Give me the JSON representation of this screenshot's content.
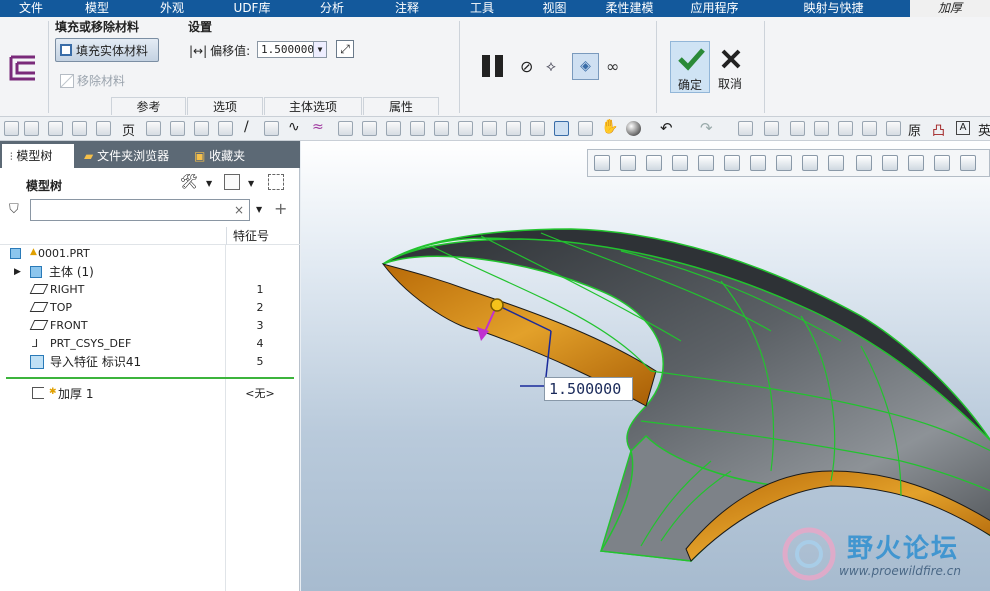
{
  "menubar": {
    "items": [
      "文件",
      "模型",
      "外观",
      "UDF库",
      "分析",
      "注释",
      "工具",
      "视图",
      "柔性建模",
      "应用程序",
      "映射与快捷"
    ],
    "active": "加厚"
  },
  "ribbon": {
    "fill_group_title": "填充或移除材料",
    "fill_solid_label": "填充实体材料",
    "remove_material_label": "移除材料",
    "settings_title": "设置",
    "offset_label": "偏移值:",
    "offset_value": "1.500000",
    "tabs": [
      "参考",
      "选项",
      "主体选项",
      "属性"
    ],
    "confirm_label": "确定",
    "cancel_label": "取消"
  },
  "toolbar_glyphs": {
    "page_letter": "页",
    "original_letter": "原",
    "text_letter": "A",
    "last_letter": "英"
  },
  "panel": {
    "tabs": [
      "模型树",
      "文件夹浏览器",
      "收藏夹"
    ],
    "tree_title": "模型树",
    "search_placeholder": "",
    "column_header": "特征号"
  },
  "tree": {
    "root": "0001.PRT",
    "rows": [
      {
        "name": "主体 (1)",
        "num": ""
      },
      {
        "name": "RIGHT",
        "num": "1"
      },
      {
        "name": "TOP",
        "num": "2"
      },
      {
        "name": "FRONT",
        "num": "3"
      },
      {
        "name": "PRT_CSYS_DEF",
        "num": "4"
      },
      {
        "name": "导入特征 标识41",
        "num": "5"
      }
    ],
    "active_feature": {
      "name": "加厚 1",
      "num": "<无>"
    }
  },
  "viewport": {
    "dimension_value": "1.500000",
    "watermark_text": "野火论坛",
    "watermark_url": "www.proewildfire.cn"
  },
  "colors": {
    "menubar": "#13599c",
    "surface_edge": "#22c32e",
    "thicken_fill": "#d99217",
    "surface_dark": "#3e4246"
  }
}
